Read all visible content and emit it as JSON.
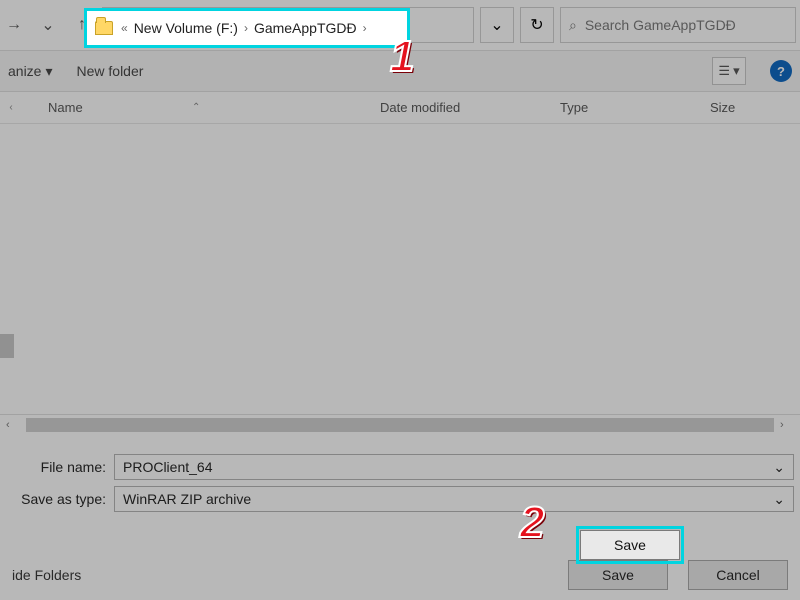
{
  "nav": {
    "back_glyph": "→",
    "up_glyph": "↑",
    "crumb_prefix": "«",
    "crumb_volume": "New Volume (F:)",
    "crumb_folder": "GameAppTGDĐ",
    "chevron": "›",
    "dropdown_glyph": "⌄",
    "refresh_glyph": "↻",
    "search_placeholder": "Search GameAppTGDĐ",
    "search_icon": "⌕"
  },
  "toolbar": {
    "organize_label": "anize",
    "organize_caret": "▾",
    "new_folder_label": "New folder",
    "view_glyph": "☰",
    "view_caret": "▾",
    "help_glyph": "?"
  },
  "columns": {
    "tree_caret": "‹",
    "name": "Name",
    "sort_glyph": "⌃",
    "date": "Date modified",
    "type": "Type",
    "size": "Size"
  },
  "fields": {
    "filename_label": "File name:",
    "filename_value": "PROClient_64",
    "savetype_label": "Save as type:",
    "savetype_value": "WinRAR ZIP archive",
    "drop_caret": "⌄"
  },
  "bottom": {
    "hide_folders": "ide Folders",
    "save": "Save",
    "cancel": "Cancel"
  },
  "annotations": {
    "step1": "1",
    "step2": "2"
  }
}
